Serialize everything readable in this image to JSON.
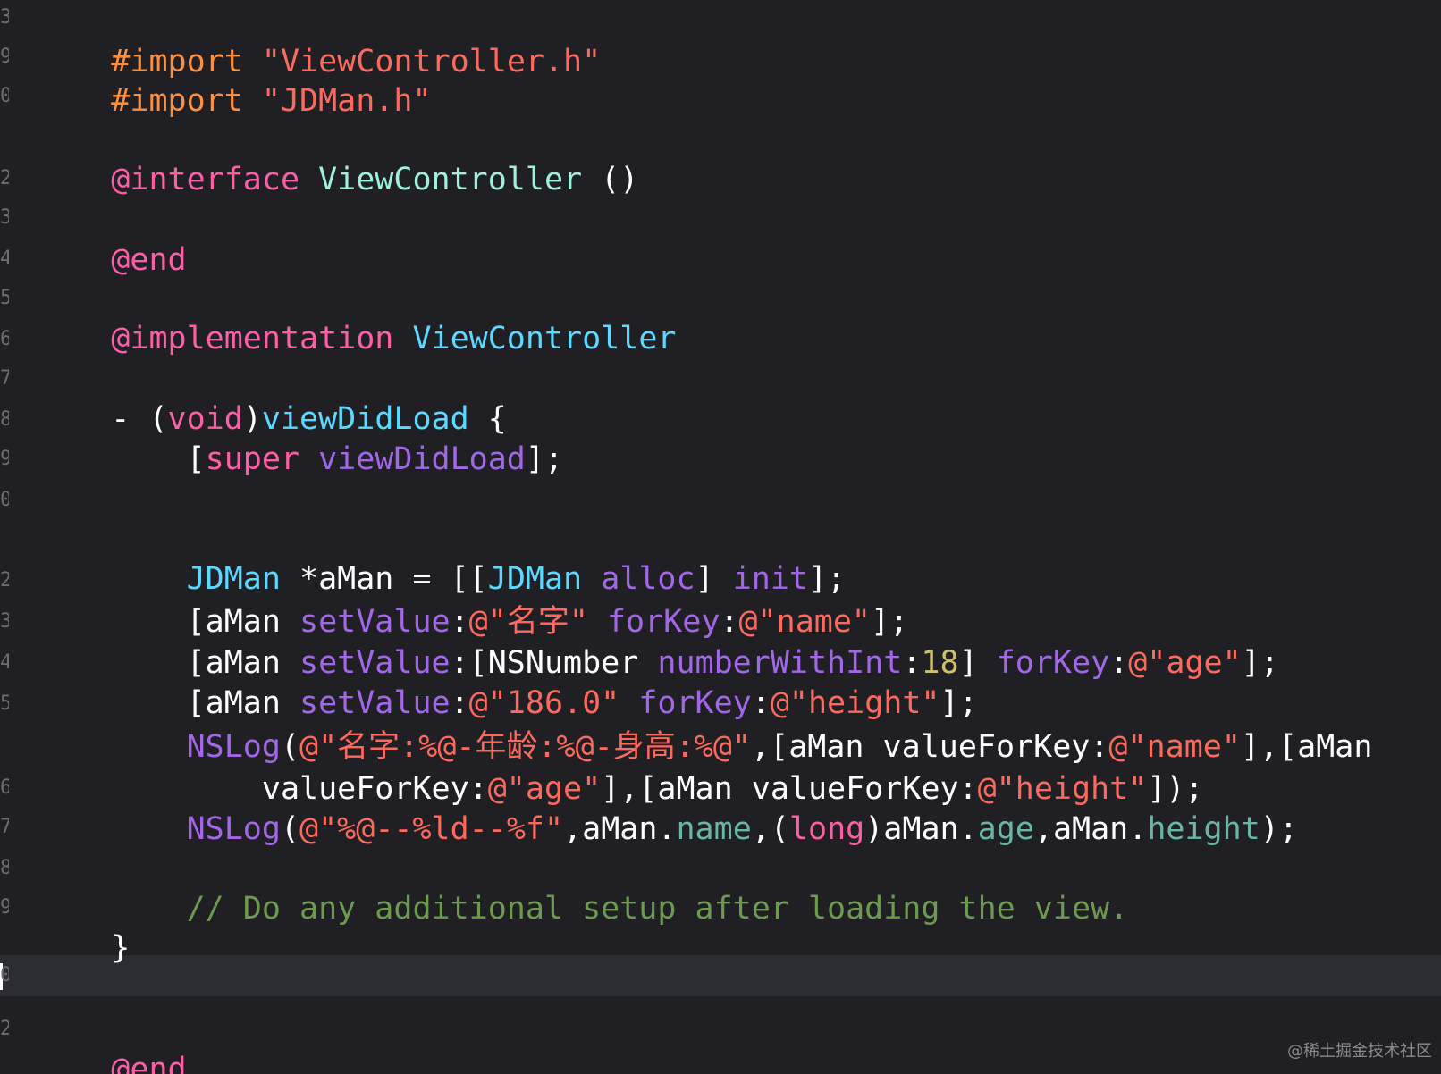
{
  "colors": {
    "background": "#1f1f24",
    "current_line": "#2b2d33",
    "preprocessor": "#fd8f3f",
    "string": "#fc6a5d",
    "keyword": "#fc5fa3",
    "class_decl": "#9ef1dd",
    "class_name": "#5dd8ff",
    "method": "#a167e6",
    "number": "#d0bf69",
    "comment": "#6c9a4e",
    "plain": "#ffffff"
  },
  "code": {
    "l1": [
      "#import",
      " ",
      "\"ViewController.h\""
    ],
    "l2": [
      "#import",
      " ",
      "\"JDMan.h\""
    ],
    "l3": [
      "@interface",
      " ",
      "ViewController",
      " ()"
    ],
    "l4": [
      "@end"
    ],
    "l5": [
      "@implementation",
      " ",
      "ViewController"
    ],
    "l6": [
      "- (",
      "void",
      ")",
      "viewDidLoad",
      " {"
    ],
    "l7": [
      "    [",
      "super",
      " ",
      "viewDidLoad",
      "];"
    ],
    "l8": [
      "    ",
      "JDMan",
      " *aMan = [[",
      "JDMan",
      " ",
      "alloc",
      "] ",
      "init",
      "];"
    ],
    "l9": [
      "    [aMan ",
      "setValue",
      ":",
      "@\"名字\"",
      " ",
      "forKey",
      ":",
      "@\"name\"",
      "];"
    ],
    "l10": [
      "    [aMan ",
      "setValue",
      ":[NSNumber ",
      "numberWithInt",
      ":",
      "18",
      "] ",
      "forKey",
      ":",
      "@\"age\"",
      "];"
    ],
    "l11": [
      "    [aMan ",
      "setValue",
      ":",
      "@\"186.0\"",
      " ",
      "forKey",
      ":",
      "@\"height\"",
      "];"
    ],
    "l12": [
      "    ",
      "NSLog",
      "(",
      "@\"名字:%@-年龄:%@-身高:%@\"",
      ",[aMan valueForKey:",
      "@\"name\"",
      "],[aMan"
    ],
    "l13": [
      "        valueForKey:",
      "@\"age\"",
      "],[aMan valueForKey:",
      "@\"height\"",
      "]);"
    ],
    "l14": [
      "    ",
      "NSLog",
      "(",
      "@\"%@--%ld--%f\"",
      ",aMan.",
      "name",
      ",(",
      "long",
      ")aMan.",
      "age",
      ",aMan.",
      "height",
      ");"
    ],
    "l15": [
      "    // Do any additional setup after loading the view."
    ],
    "l16": [
      "}"
    ],
    "l17": [
      "@end"
    ]
  },
  "gutter": [
    "3",
    "9",
    "0",
    "",
    "2",
    "3",
    "4",
    "5",
    "6",
    "7",
    "8",
    "9",
    "0",
    "",
    "2",
    "3",
    "4",
    "5",
    "6",
    "7",
    "8",
    "9",
    "0",
    "",
    "2"
  ],
  "watermark": "@稀土掘金技术社区"
}
